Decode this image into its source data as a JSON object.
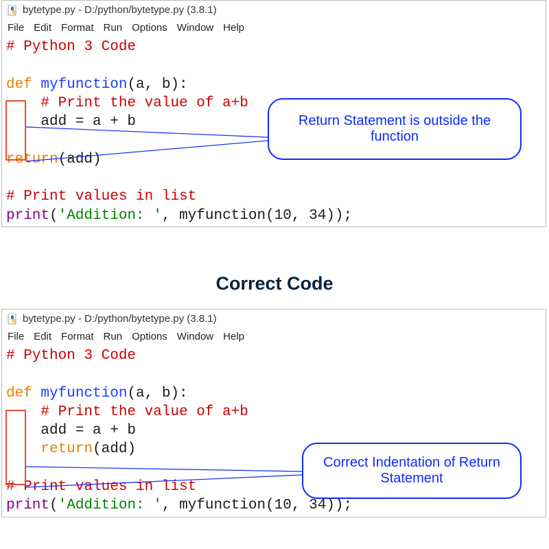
{
  "heading": "Correct Code",
  "titlebar": {
    "text": "bytetype.py - D:/python/bytetype.py (3.8.1)"
  },
  "menu": {
    "file": "File",
    "edit": "Edit",
    "format": "Format",
    "run": "Run",
    "options": "Options",
    "window": "Window",
    "help": "Help"
  },
  "code_top": {
    "line1_comment": "# Python 3 Code",
    "def_kw": "def",
    "func_name": " myfunction",
    "def_rest": "(a, b):",
    "line4_comment": "    # Print the value of a+b",
    "line5_assign": "    add = a + b",
    "return_kw": "return",
    "return_rest": "(add)",
    "line8_comment": "# Print values in list",
    "print_kw": "print",
    "print_open": "(",
    "print_str": "'Addition: '",
    "print_rest": ", myfunction(10, 34));"
  },
  "code_bottom": {
    "line1_comment": "# Python 3 Code",
    "def_kw": "def",
    "func_name": " myfunction",
    "def_rest": "(a, b):",
    "line4_comment": "    # Print the value of a+b",
    "line5_assign": "    add = a + b",
    "return_indent": "    ",
    "return_kw": "return",
    "return_rest": "(add)",
    "line8_comment": "# Print values in list",
    "print_kw": "print",
    "print_open": "(",
    "print_str": "'Addition: '",
    "print_rest": ", myfunction(10, 34));"
  },
  "callouts": {
    "top": "Return Statement is outside the function",
    "bottom": "Correct Indentation of Return Statement"
  }
}
